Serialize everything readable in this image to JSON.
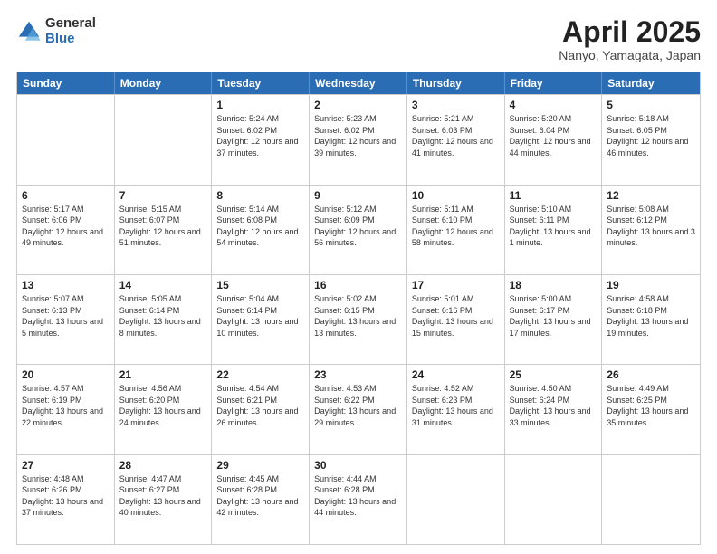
{
  "logo": {
    "general": "General",
    "blue": "Blue"
  },
  "title": "April 2025",
  "subtitle": "Nanyo, Yamagata, Japan",
  "header_days": [
    "Sunday",
    "Monday",
    "Tuesday",
    "Wednesday",
    "Thursday",
    "Friday",
    "Saturday"
  ],
  "weeks": [
    [
      {
        "day": "",
        "info": ""
      },
      {
        "day": "",
        "info": ""
      },
      {
        "day": "1",
        "info": "Sunrise: 5:24 AM\nSunset: 6:02 PM\nDaylight: 12 hours and 37 minutes."
      },
      {
        "day": "2",
        "info": "Sunrise: 5:23 AM\nSunset: 6:02 PM\nDaylight: 12 hours and 39 minutes."
      },
      {
        "day": "3",
        "info": "Sunrise: 5:21 AM\nSunset: 6:03 PM\nDaylight: 12 hours and 41 minutes."
      },
      {
        "day": "4",
        "info": "Sunrise: 5:20 AM\nSunset: 6:04 PM\nDaylight: 12 hours and 44 minutes."
      },
      {
        "day": "5",
        "info": "Sunrise: 5:18 AM\nSunset: 6:05 PM\nDaylight: 12 hours and 46 minutes."
      }
    ],
    [
      {
        "day": "6",
        "info": "Sunrise: 5:17 AM\nSunset: 6:06 PM\nDaylight: 12 hours and 49 minutes."
      },
      {
        "day": "7",
        "info": "Sunrise: 5:15 AM\nSunset: 6:07 PM\nDaylight: 12 hours and 51 minutes."
      },
      {
        "day": "8",
        "info": "Sunrise: 5:14 AM\nSunset: 6:08 PM\nDaylight: 12 hours and 54 minutes."
      },
      {
        "day": "9",
        "info": "Sunrise: 5:12 AM\nSunset: 6:09 PM\nDaylight: 12 hours and 56 minutes."
      },
      {
        "day": "10",
        "info": "Sunrise: 5:11 AM\nSunset: 6:10 PM\nDaylight: 12 hours and 58 minutes."
      },
      {
        "day": "11",
        "info": "Sunrise: 5:10 AM\nSunset: 6:11 PM\nDaylight: 13 hours and 1 minute."
      },
      {
        "day": "12",
        "info": "Sunrise: 5:08 AM\nSunset: 6:12 PM\nDaylight: 13 hours and 3 minutes."
      }
    ],
    [
      {
        "day": "13",
        "info": "Sunrise: 5:07 AM\nSunset: 6:13 PM\nDaylight: 13 hours and 5 minutes."
      },
      {
        "day": "14",
        "info": "Sunrise: 5:05 AM\nSunset: 6:14 PM\nDaylight: 13 hours and 8 minutes."
      },
      {
        "day": "15",
        "info": "Sunrise: 5:04 AM\nSunset: 6:14 PM\nDaylight: 13 hours and 10 minutes."
      },
      {
        "day": "16",
        "info": "Sunrise: 5:02 AM\nSunset: 6:15 PM\nDaylight: 13 hours and 13 minutes."
      },
      {
        "day": "17",
        "info": "Sunrise: 5:01 AM\nSunset: 6:16 PM\nDaylight: 13 hours and 15 minutes."
      },
      {
        "day": "18",
        "info": "Sunrise: 5:00 AM\nSunset: 6:17 PM\nDaylight: 13 hours and 17 minutes."
      },
      {
        "day": "19",
        "info": "Sunrise: 4:58 AM\nSunset: 6:18 PM\nDaylight: 13 hours and 19 minutes."
      }
    ],
    [
      {
        "day": "20",
        "info": "Sunrise: 4:57 AM\nSunset: 6:19 PM\nDaylight: 13 hours and 22 minutes."
      },
      {
        "day": "21",
        "info": "Sunrise: 4:56 AM\nSunset: 6:20 PM\nDaylight: 13 hours and 24 minutes."
      },
      {
        "day": "22",
        "info": "Sunrise: 4:54 AM\nSunset: 6:21 PM\nDaylight: 13 hours and 26 minutes."
      },
      {
        "day": "23",
        "info": "Sunrise: 4:53 AM\nSunset: 6:22 PM\nDaylight: 13 hours and 29 minutes."
      },
      {
        "day": "24",
        "info": "Sunrise: 4:52 AM\nSunset: 6:23 PM\nDaylight: 13 hours and 31 minutes."
      },
      {
        "day": "25",
        "info": "Sunrise: 4:50 AM\nSunset: 6:24 PM\nDaylight: 13 hours and 33 minutes."
      },
      {
        "day": "26",
        "info": "Sunrise: 4:49 AM\nSunset: 6:25 PM\nDaylight: 13 hours and 35 minutes."
      }
    ],
    [
      {
        "day": "27",
        "info": "Sunrise: 4:48 AM\nSunset: 6:26 PM\nDaylight: 13 hours and 37 minutes."
      },
      {
        "day": "28",
        "info": "Sunrise: 4:47 AM\nSunset: 6:27 PM\nDaylight: 13 hours and 40 minutes."
      },
      {
        "day": "29",
        "info": "Sunrise: 4:45 AM\nSunset: 6:28 PM\nDaylight: 13 hours and 42 minutes."
      },
      {
        "day": "30",
        "info": "Sunrise: 4:44 AM\nSunset: 6:28 PM\nDaylight: 13 hours and 44 minutes."
      },
      {
        "day": "",
        "info": ""
      },
      {
        "day": "",
        "info": ""
      },
      {
        "day": "",
        "info": ""
      }
    ]
  ]
}
